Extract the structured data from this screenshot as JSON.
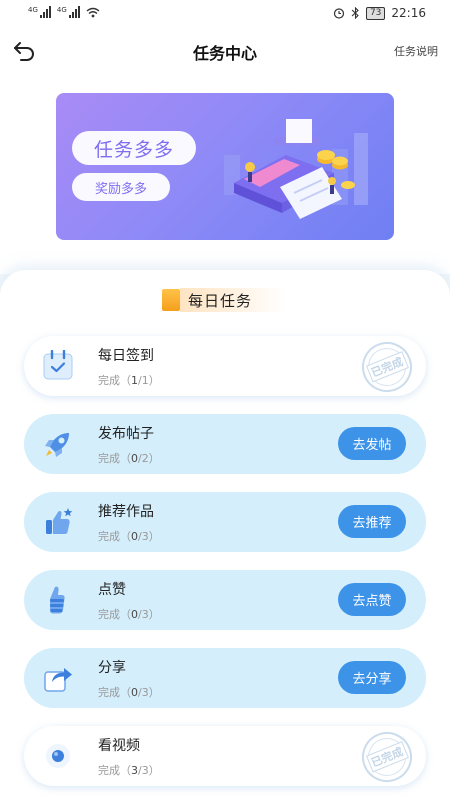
{
  "statusbar": {
    "net1": "4G",
    "net2": "4G",
    "battery": "73",
    "time": "22:16"
  },
  "header": {
    "title": "任务中心",
    "help": "任务说明"
  },
  "banner": {
    "headline": "任务多多",
    "sub": "奖励多多"
  },
  "section": {
    "title": "每日任务"
  },
  "tasks": [
    {
      "name": "每日签到",
      "prog_prefix": "完成（",
      "done": "1",
      "sep": "/",
      "total": "1",
      "prog_suffix": "）",
      "stamp": "已完成"
    },
    {
      "name": "发布帖子",
      "prog_prefix": "完成（",
      "done": "0",
      "sep": "/",
      "total": "2",
      "prog_suffix": "）",
      "action": "去发帖"
    },
    {
      "name": "推荐作品",
      "prog_prefix": "完成（",
      "done": "0",
      "sep": "/",
      "total": "3",
      "prog_suffix": "）",
      "action": "去推荐"
    },
    {
      "name": "点赞",
      "prog_prefix": "完成（",
      "done": "0",
      "sep": "/",
      "total": "3",
      "prog_suffix": "）",
      "action": "去点赞"
    },
    {
      "name": "分享",
      "prog_prefix": "完成（",
      "done": "0",
      "sep": "/",
      "total": "3",
      "prog_suffix": "）",
      "action": "去分享"
    },
    {
      "name": "看视频",
      "prog_prefix": "完成（",
      "done": "3",
      "sep": "/",
      "total": "3",
      "prog_suffix": "）",
      "stamp": "已完成"
    }
  ],
  "colors": {
    "accent": "#3d93e8",
    "todo_bg": "#d4eefb",
    "banner_start": "#a98bf6",
    "banner_end": "#6f7ff3"
  },
  "icons": [
    "back-arrow-icon",
    "calendar-check-icon",
    "rocket-icon",
    "thumbs-up-star-icon",
    "thumbs-up-hand-icon",
    "share-arrow-icon",
    "video-play-icon"
  ]
}
